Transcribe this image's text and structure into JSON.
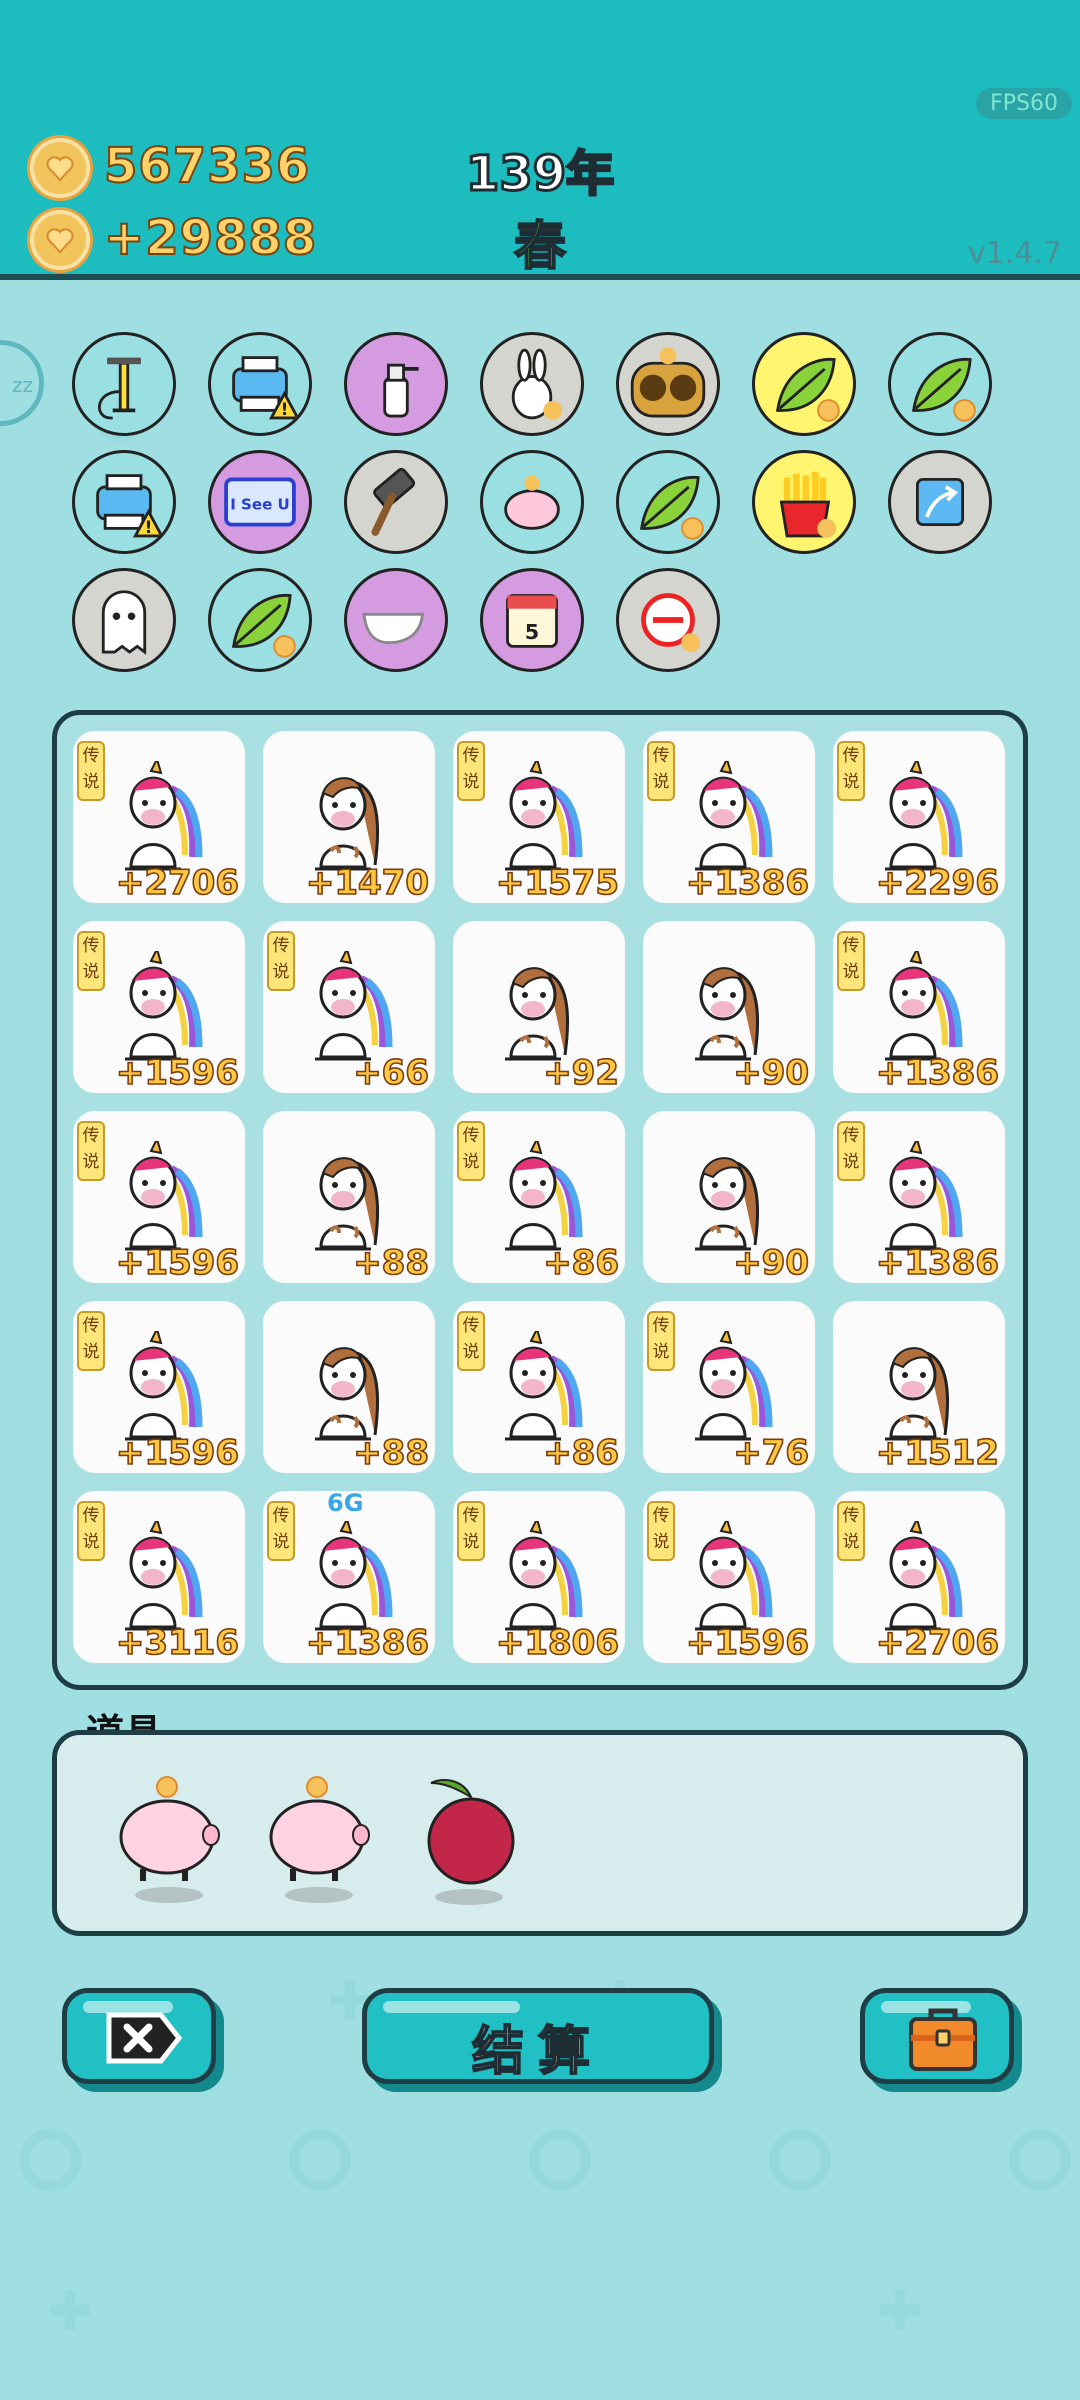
{
  "header": {
    "fps": "FPS60",
    "version": "v1.4.7",
    "gold": "567336",
    "income": "+29888",
    "year": "139年",
    "season": "春"
  },
  "side_button": {
    "label": "zz"
  },
  "items": [
    {
      "name": "air-pump-icon",
      "row": 0,
      "col": 0,
      "bg": "#9ae0e3"
    },
    {
      "name": "printer-warning-icon",
      "row": 0,
      "col": 1,
      "bg": "#9ae0e3"
    },
    {
      "name": "spray-bottle-icon",
      "row": 0,
      "col": 2,
      "bg": "#d49be0"
    },
    {
      "name": "bunny-icon",
      "row": 0,
      "col": 3,
      "bg": "#d5d5cf"
    },
    {
      "name": "owl-icon",
      "row": 0,
      "col": 4,
      "bg": "#d5d5cf"
    },
    {
      "name": "leaf-coin-icon",
      "row": 0,
      "col": 5,
      "bg": "#fff56e"
    },
    {
      "name": "leaf-coin-icon",
      "row": 0,
      "col": 6,
      "bg": "#9ae0e3"
    },
    {
      "name": "printer-warning-icon",
      "row": 1,
      "col": 0,
      "bg": "#9ae0e3"
    },
    {
      "name": "i-see-u-icon",
      "row": 1,
      "col": 1,
      "bg": "#d49be0",
      "text": "I See U"
    },
    {
      "name": "hammer-icon",
      "row": 1,
      "col": 2,
      "bg": "#d5d5cf"
    },
    {
      "name": "piggy-bank-icon",
      "row": 1,
      "col": 3,
      "bg": "#9ae0e3"
    },
    {
      "name": "leaf-coin-icon",
      "row": 1,
      "col": 4,
      "bg": "#9ae0e3"
    },
    {
      "name": "french-fries-icon",
      "row": 1,
      "col": 5,
      "bg": "#fff56e"
    },
    {
      "name": "arrow-up-card-icon",
      "row": 1,
      "col": 6,
      "bg": "#d5d5cf"
    },
    {
      "name": "ghost-icon",
      "row": 2,
      "col": 0,
      "bg": "#d5d5cf"
    },
    {
      "name": "leaf-coin-icon",
      "row": 2,
      "col": 1,
      "bg": "#9ae0e3"
    },
    {
      "name": "gravy-boat-icon",
      "row": 2,
      "col": 2,
      "bg": "#d49be0"
    },
    {
      "name": "calendar-icon",
      "row": 2,
      "col": 3,
      "bg": "#d49be0",
      "text": "5"
    },
    {
      "name": "no-entry-icon",
      "row": 2,
      "col": 4,
      "bg": "#d5d5cf"
    }
  ],
  "board": {
    "legend_tag": "传说",
    "cells": [
      {
        "kind": "unicorn",
        "legend": true,
        "value": "+2706"
      },
      {
        "kind": "horse",
        "legend": false,
        "value": "+1470"
      },
      {
        "kind": "unicorn",
        "legend": true,
        "value": "+1575"
      },
      {
        "kind": "unicorn",
        "legend": true,
        "value": "+1386"
      },
      {
        "kind": "unicorn",
        "legend": true,
        "value": "+2296"
      },
      {
        "kind": "unicorn",
        "legend": true,
        "value": "+1596"
      },
      {
        "kind": "unicorn",
        "legend": true,
        "value": "+66"
      },
      {
        "kind": "horse",
        "legend": false,
        "value": "+92"
      },
      {
        "kind": "horse",
        "legend": false,
        "value": "+90"
      },
      {
        "kind": "unicorn",
        "legend": true,
        "value": "+1386"
      },
      {
        "kind": "unicorn",
        "legend": true,
        "value": "+1596"
      },
      {
        "kind": "horse",
        "legend": false,
        "value": "+88"
      },
      {
        "kind": "unicorn",
        "legend": true,
        "value": "+86"
      },
      {
        "kind": "horse",
        "legend": false,
        "value": "+90"
      },
      {
        "kind": "unicorn",
        "legend": true,
        "value": "+1386"
      },
      {
        "kind": "unicorn",
        "legend": true,
        "value": "+1596"
      },
      {
        "kind": "horse",
        "legend": false,
        "value": "+88"
      },
      {
        "kind": "unicorn",
        "legend": true,
        "value": "+86"
      },
      {
        "kind": "unicorn",
        "legend": true,
        "value": "+76"
      },
      {
        "kind": "horse",
        "legend": false,
        "value": "+1512"
      },
      {
        "kind": "unicorn",
        "legend": true,
        "value": "+3116"
      },
      {
        "kind": "unicorn",
        "legend": true,
        "value": "+1386",
        "extra": "6G"
      },
      {
        "kind": "unicorn",
        "legend": true,
        "value": "+1806"
      },
      {
        "kind": "unicorn",
        "legend": true,
        "value": "+1596"
      },
      {
        "kind": "unicorn",
        "legend": true,
        "value": "+2706"
      }
    ]
  },
  "props": {
    "title": "道具",
    "items": [
      "piggy-bank-icon",
      "piggy-bank-icon",
      "bayberry-icon"
    ]
  },
  "buttons": {
    "settle_label": "结算"
  },
  "colors": {
    "header_bg": "#1dbcbf",
    "page_bg": "#9fdfe2",
    "value_text": "#ffc842",
    "accent": "#20c0c4"
  }
}
